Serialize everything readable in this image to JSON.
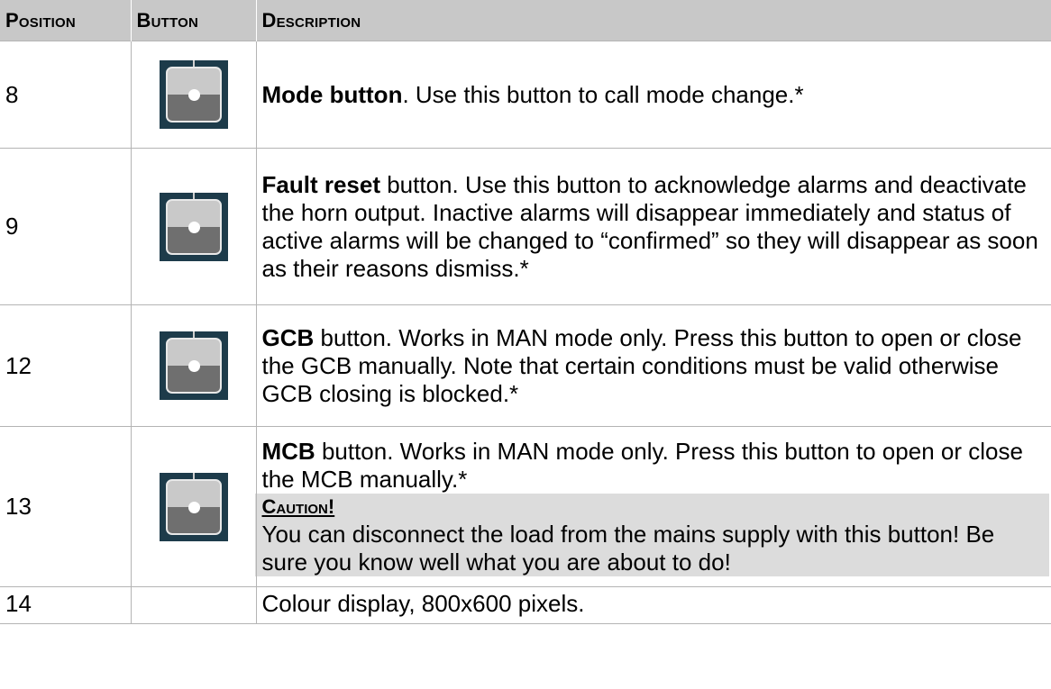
{
  "header": {
    "position": "Position",
    "button": "Button",
    "description": "Description"
  },
  "rows": [
    {
      "position": "8",
      "icon": "mode-button-icon",
      "bold": "Mode button",
      "text": ". Use this button to call mode change.*"
    },
    {
      "position": "9",
      "icon": "fault-reset-button-icon",
      "bold": "Fault reset",
      "text": " button. Use this button to acknowledge alarms and deactivate the horn output. Inactive alarms will disappear immediately and status of active alarms will be changed to “confirmed” so they will disappear as soon as their reasons dismiss.*"
    },
    {
      "position": "12",
      "icon": "gcb-button-icon",
      "bold": "GCB",
      "text": " button. Works in MAN mode only. Press this button to open or close the GCB manually. Note that certain conditions must be valid otherwise GCB closing is blocked.*"
    },
    {
      "position": "13",
      "icon": "mcb-button-icon",
      "bold": "MCB",
      "text": " button. Works in MAN mode only. Press this button to open or close the MCB manually.*",
      "caution_title": "Caution!",
      "caution_text": "You can disconnect the load from the mains supply with this button! Be sure you know well what you are about to do!"
    },
    {
      "position": "14",
      "text": "Colour display, 800x600 pixels."
    }
  ],
  "colors": {
    "header_bg": "#c8c8c8",
    "caution_bg": "#dcdcdc",
    "button_frame": "#1d3b4a",
    "button_top": "#c9c9c9",
    "button_bottom": "#6f6f6f"
  }
}
